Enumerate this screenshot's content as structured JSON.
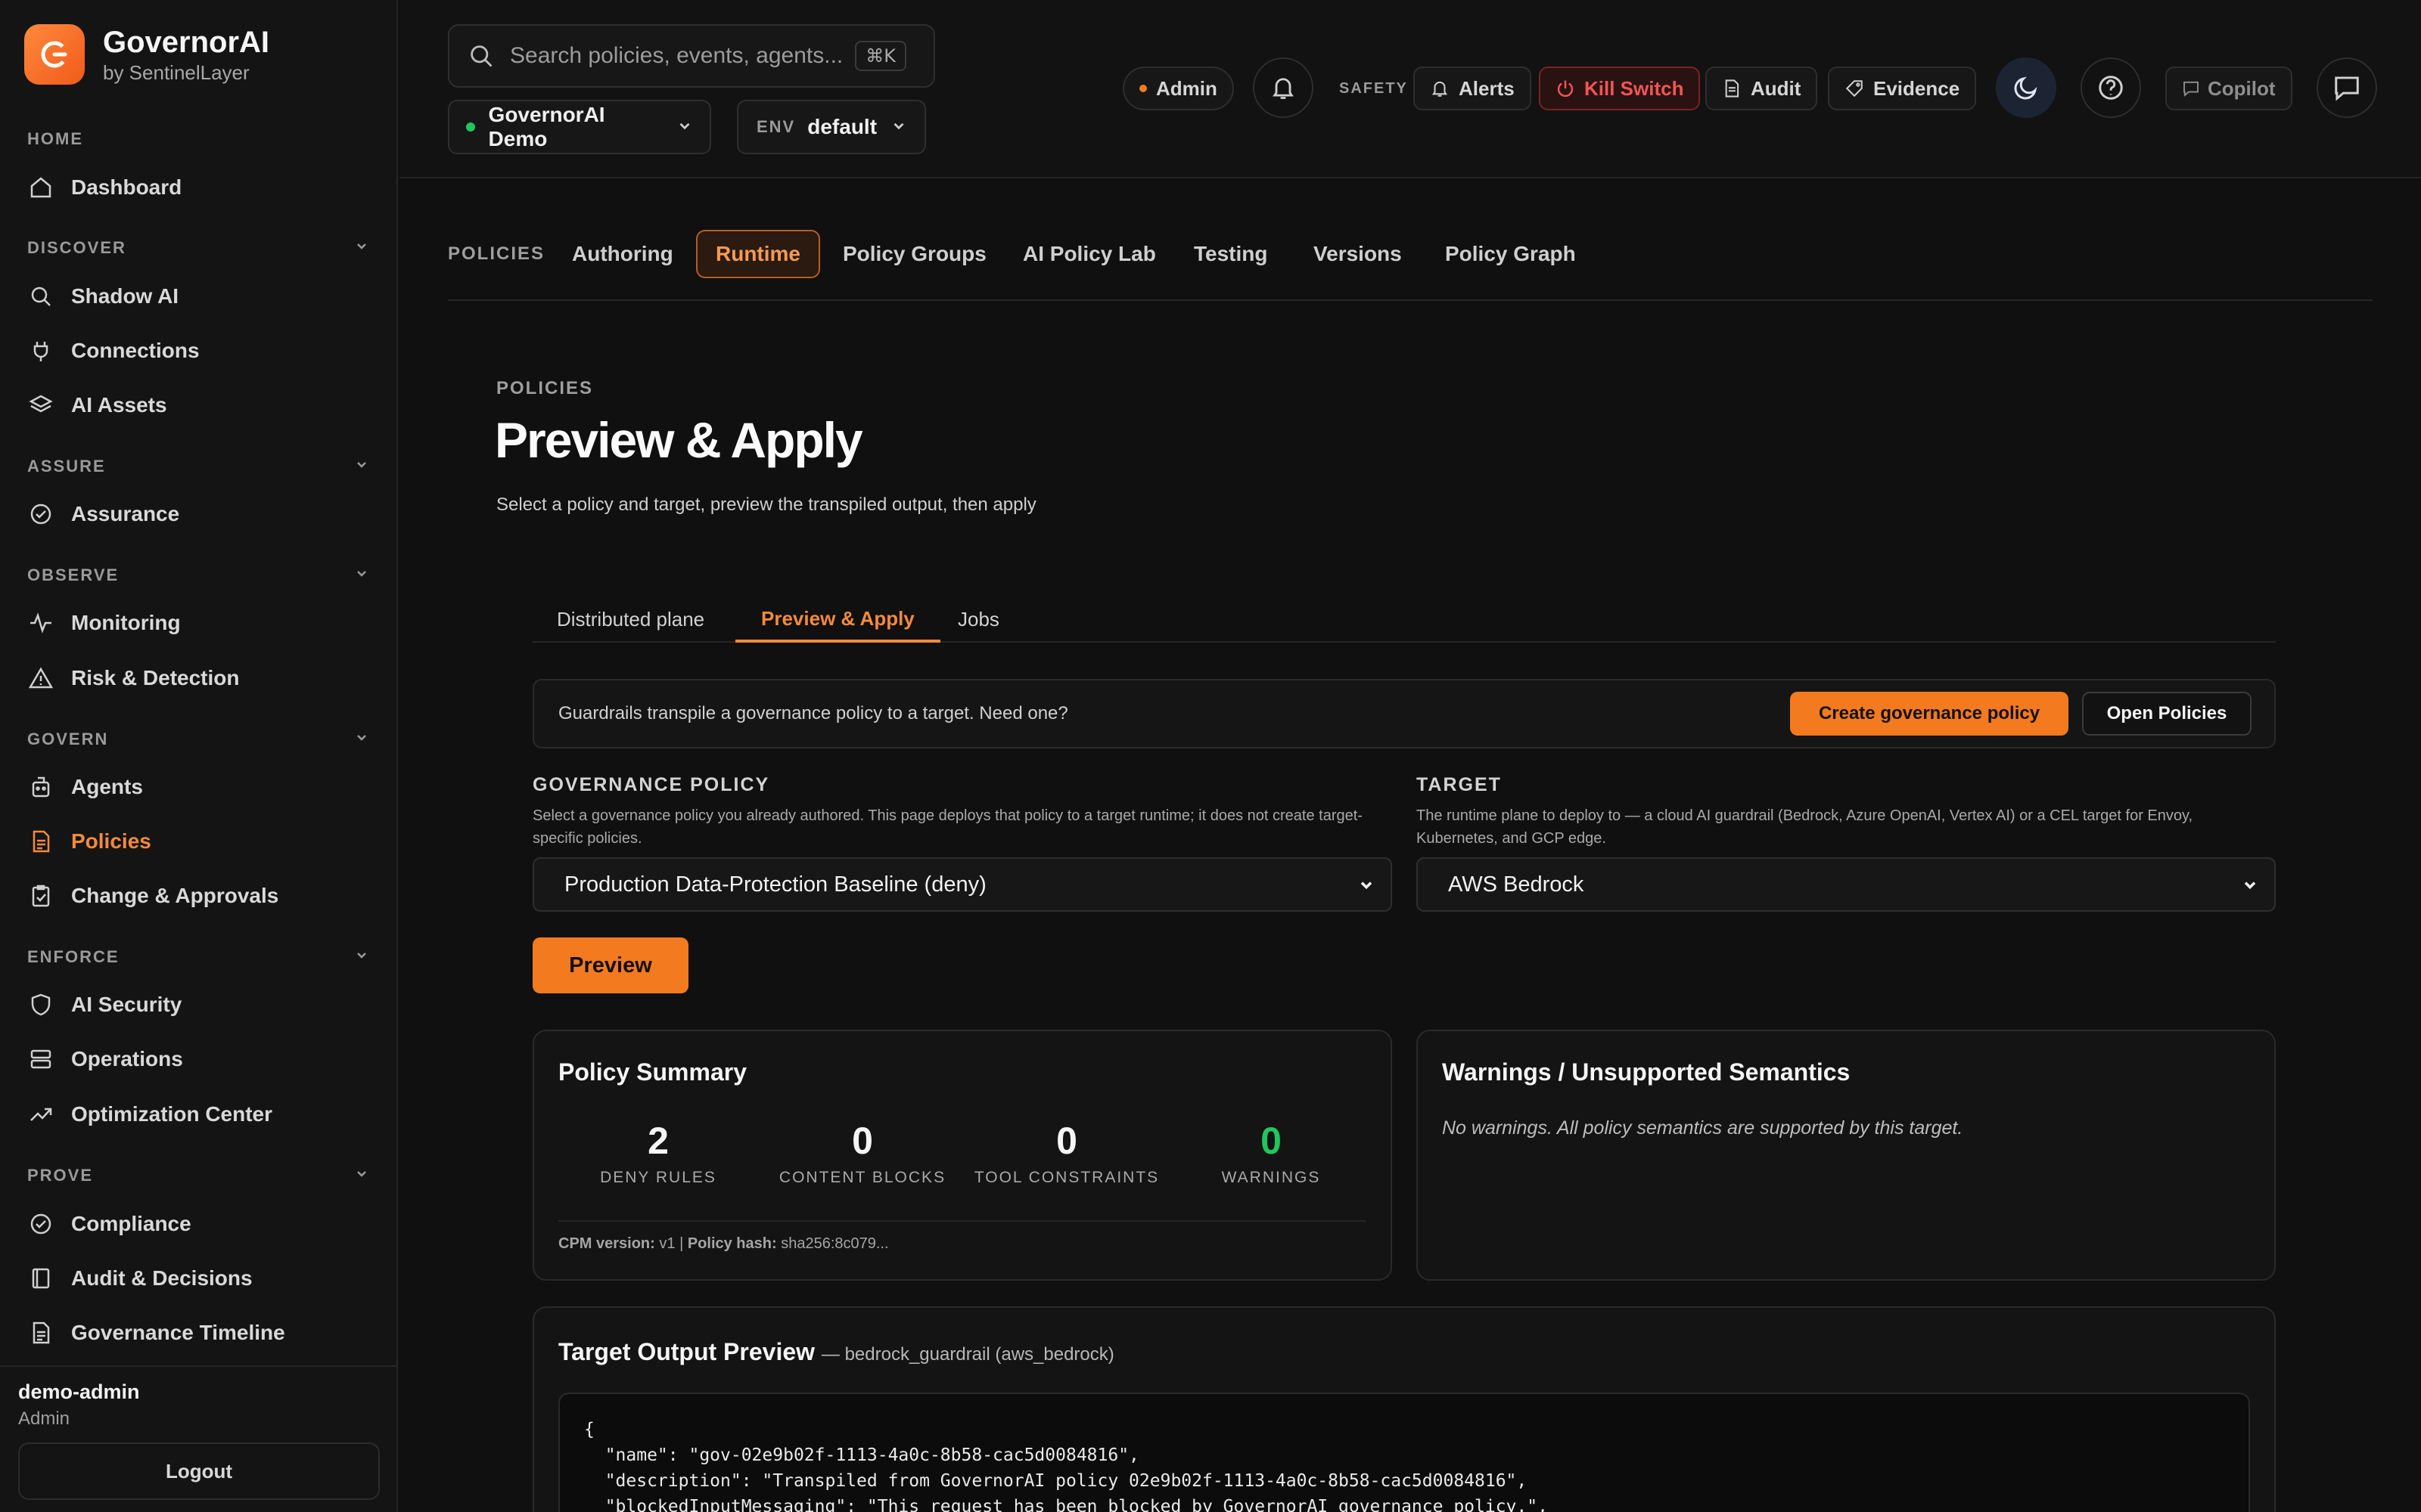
{
  "brand": {
    "name": "GovernorAI",
    "sub": "by SentinelLayer"
  },
  "sidebar": {
    "home_label": "HOME",
    "dashboard": "Dashboard",
    "sections": {
      "discover": "DISCOVER",
      "assure": "ASSURE",
      "observe": "OBSERVE",
      "govern": "GOVERN",
      "enforce": "ENFORCE",
      "prove": "PROVE"
    },
    "items": {
      "shadow_ai": "Shadow AI",
      "connections": "Connections",
      "ai_assets": "AI Assets",
      "assurance": "Assurance",
      "monitoring": "Monitoring",
      "risk_detection": "Risk & Detection",
      "agents": "Agents",
      "policies": "Policies",
      "change_approvals": "Change & Approvals",
      "ai_security": "AI Security",
      "operations": "Operations",
      "optimization_center": "Optimization Center",
      "compliance": "Compliance",
      "audit_decisions": "Audit & Decisions",
      "governance_timeline": "Governance Timeline"
    },
    "user": {
      "name": "demo-admin",
      "role": "Admin"
    },
    "logout": "Logout"
  },
  "topbar": {
    "search_placeholder": "Search policies, events, agents...",
    "search_shortcut": "⌘K",
    "org": "GovernorAI Demo",
    "env_label": "ENV",
    "env_value": "default",
    "admin": "Admin",
    "safety_label": "SAFETY",
    "alerts": "Alerts",
    "kill_switch": "Kill Switch",
    "audit": "Audit",
    "evidence": "Evidence",
    "copilot": "Copilot"
  },
  "policy_tabs": {
    "caption": "POLICIES",
    "items": [
      "Authoring",
      "Runtime",
      "Policy Groups",
      "AI Policy Lab",
      "Testing",
      "Versions",
      "Policy Graph"
    ],
    "active": "Runtime"
  },
  "page": {
    "crumb": "POLICIES",
    "title": "Preview & Apply",
    "subtitle": "Select a policy and target, preview the transpiled output, then apply"
  },
  "subtabs": {
    "items": [
      "Distributed plane",
      "Preview & Apply",
      "Jobs"
    ],
    "active": "Preview & Apply"
  },
  "banner": {
    "text": "Guardrails transpile a governance policy to a target. Need one?",
    "create": "Create governance policy",
    "open": "Open Policies"
  },
  "form": {
    "policy_label": "GOVERNANCE POLICY",
    "policy_help": "Select a governance policy you already authored. This page deploys that policy to a target runtime; it does not create target-specific policies.",
    "policy_value": "Production Data-Protection Baseline (deny)",
    "target_label": "TARGET",
    "target_help": "The runtime plane to deploy to — a cloud AI guardrail (Bedrock, Azure OpenAI, Vertex AI) or a CEL target for Envoy, Kubernetes, and GCP edge.",
    "target_value": "AWS Bedrock",
    "preview_button": "Preview"
  },
  "summary": {
    "title": "Policy Summary",
    "stats": [
      {
        "value": "2",
        "label": "DENY RULES"
      },
      {
        "value": "0",
        "label": "CONTENT BLOCKS"
      },
      {
        "value": "0",
        "label": "TOOL CONSTRAINTS"
      },
      {
        "value": "0",
        "label": "WARNINGS"
      }
    ],
    "footer_label1": "CPM version:",
    "footer_value1": "v1",
    "footer_sep": "|",
    "footer_label2": "Policy hash:",
    "footer_value2": "sha256:8c079..."
  },
  "warnings": {
    "title": "Warnings / Unsupported Semantics",
    "text": "No warnings. All policy semantics are supported by this target."
  },
  "output": {
    "title": "Target Output Preview",
    "subtitle": "— bedrock_guardrail (aws_bedrock)",
    "lines": [
      "{",
      "  \"name\": \"gov-02e9b02f-1113-4a0c-8b58-cac5d0084816\",",
      "  \"description\": \"Transpiled from GovernorAI policy 02e9b02f-1113-4a0c-8b58-cac5d0084816\",",
      "  \"blockedInputMessaging\": \"This request has been blocked by GovernorAI governance policy.\","
    ]
  },
  "colors": {
    "accent": "#f47a1f",
    "danger": "#ef4444",
    "success": "#22c55e"
  }
}
